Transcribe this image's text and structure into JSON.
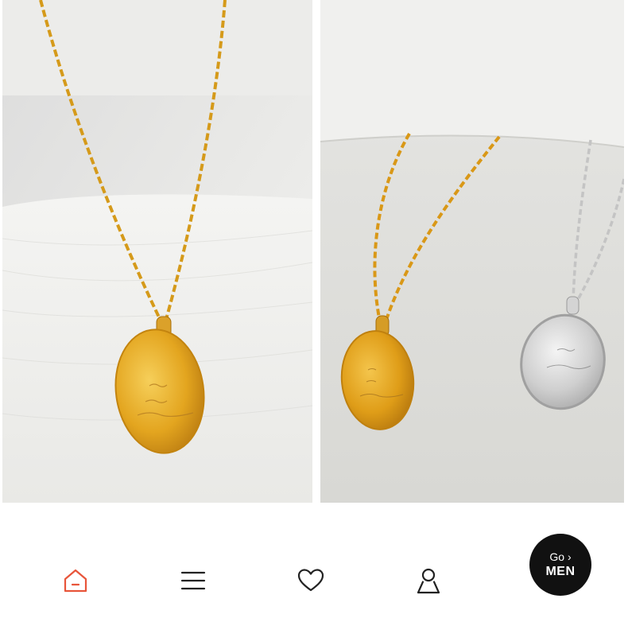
{
  "gallery": {
    "images": [
      {
        "subject": "gold-necklace-on-fabric"
      },
      {
        "subject": "gold-and-silver-necklaces-on-display"
      }
    ]
  },
  "bottom_nav": {
    "items": [
      {
        "id": "home",
        "icon": "home-icon",
        "active": true
      },
      {
        "id": "menu",
        "icon": "menu-icon",
        "active": false
      },
      {
        "id": "wishlist",
        "icon": "heart-icon",
        "active": false
      },
      {
        "id": "account",
        "icon": "user-icon",
        "active": false
      }
    ],
    "go_men": {
      "go_label": "Go ›",
      "men_label": "MEN"
    }
  },
  "colors": {
    "active": "#e8553a",
    "icon": "#222222",
    "go_men_bg": "#111111",
    "gold": "#e0a21c",
    "silver": "#d9d9d9"
  }
}
